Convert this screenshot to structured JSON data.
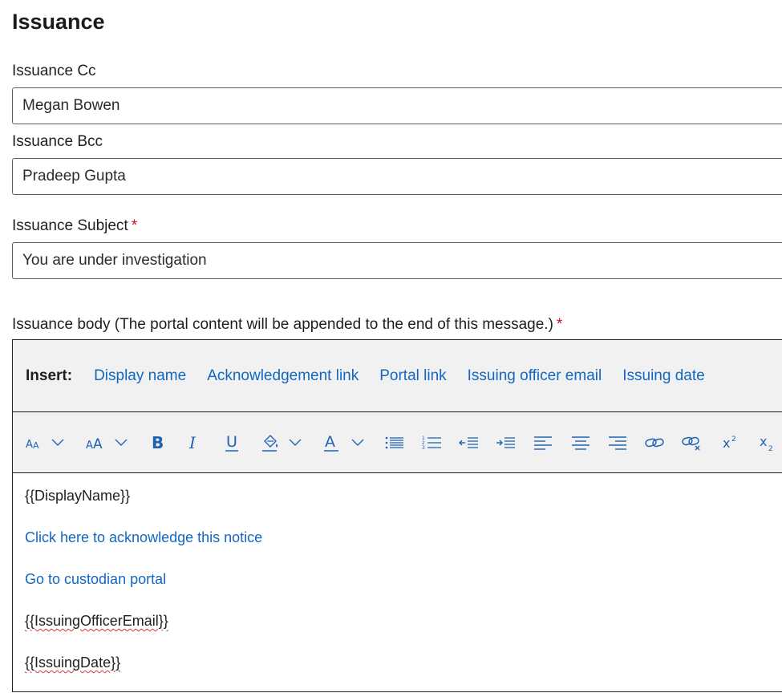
{
  "page": {
    "title": "Issuance"
  },
  "cc": {
    "label": "Issuance Cc",
    "value": "Megan Bowen"
  },
  "bcc": {
    "label": "Issuance Bcc",
    "value": "Pradeep Gupta"
  },
  "subject": {
    "label": "Issuance Subject",
    "required_mark": "*",
    "value": "You are under investigation"
  },
  "body": {
    "label": "Issuance body (The portal content will be appended to the end of this message.)",
    "required_mark": "*",
    "insert_label": "Insert:",
    "insert_links": [
      "Display name",
      "Acknowledgement link",
      "Portal link",
      "Issuing officer email",
      "Issuing date"
    ],
    "toolbar_icons": [
      "font-size-decrease-icon",
      "font-size-increase-icon",
      "bold-icon",
      "italic-icon",
      "underline-icon",
      "highlight-icon",
      "font-color-icon",
      "bullet-list-icon",
      "numbered-list-icon",
      "outdent-icon",
      "indent-icon",
      "align-left-icon",
      "align-center-icon",
      "align-right-icon",
      "link-icon",
      "unlink-icon",
      "superscript-icon",
      "subscript-icon"
    ],
    "content": {
      "display_name_placeholder": "{{DisplayName}}",
      "ack_link": "Click here to acknowledge this notice",
      "portal_link": "Go to custodian portal",
      "officer_email_placeholder": "{{IssuingOfficerEmail}}",
      "issuing_date_placeholder": "{{IssuingDate}}"
    }
  },
  "colors": {
    "link": "#1367c0",
    "toolbar_icon": "#1e62b4",
    "required": "#c50f1f",
    "toolbar_bg": "#f1f1f1"
  }
}
